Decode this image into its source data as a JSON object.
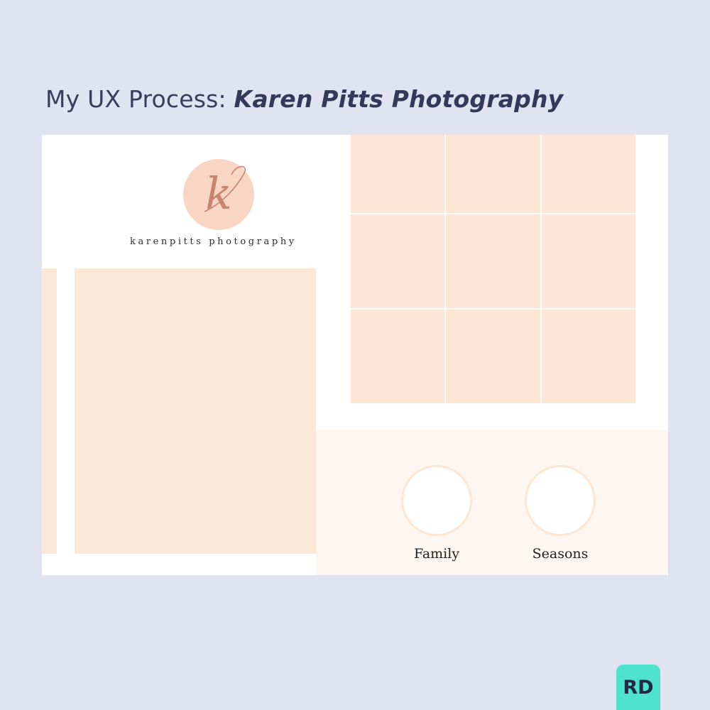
{
  "header": {
    "title_prefix": "My UX Process: ",
    "title_emphasis": "Karen Pitts Photography"
  },
  "mockup": {
    "logo": {
      "monogram": "k",
      "brand_name": "karenpitts photography"
    },
    "photo_grid": {
      "rows": 3,
      "columns": 3
    },
    "categories": [
      {
        "label": "Family"
      },
      {
        "label": "Seasons"
      }
    ]
  },
  "badge": {
    "label": "RD"
  },
  "colors": {
    "background": "#dfe4f0",
    "title_text": "#3a3d5c",
    "placeholder_peach": "#fde8d8",
    "logo_circle": "#f9d6c4",
    "monogram": "#c98470",
    "badge": "#4de3cf"
  }
}
